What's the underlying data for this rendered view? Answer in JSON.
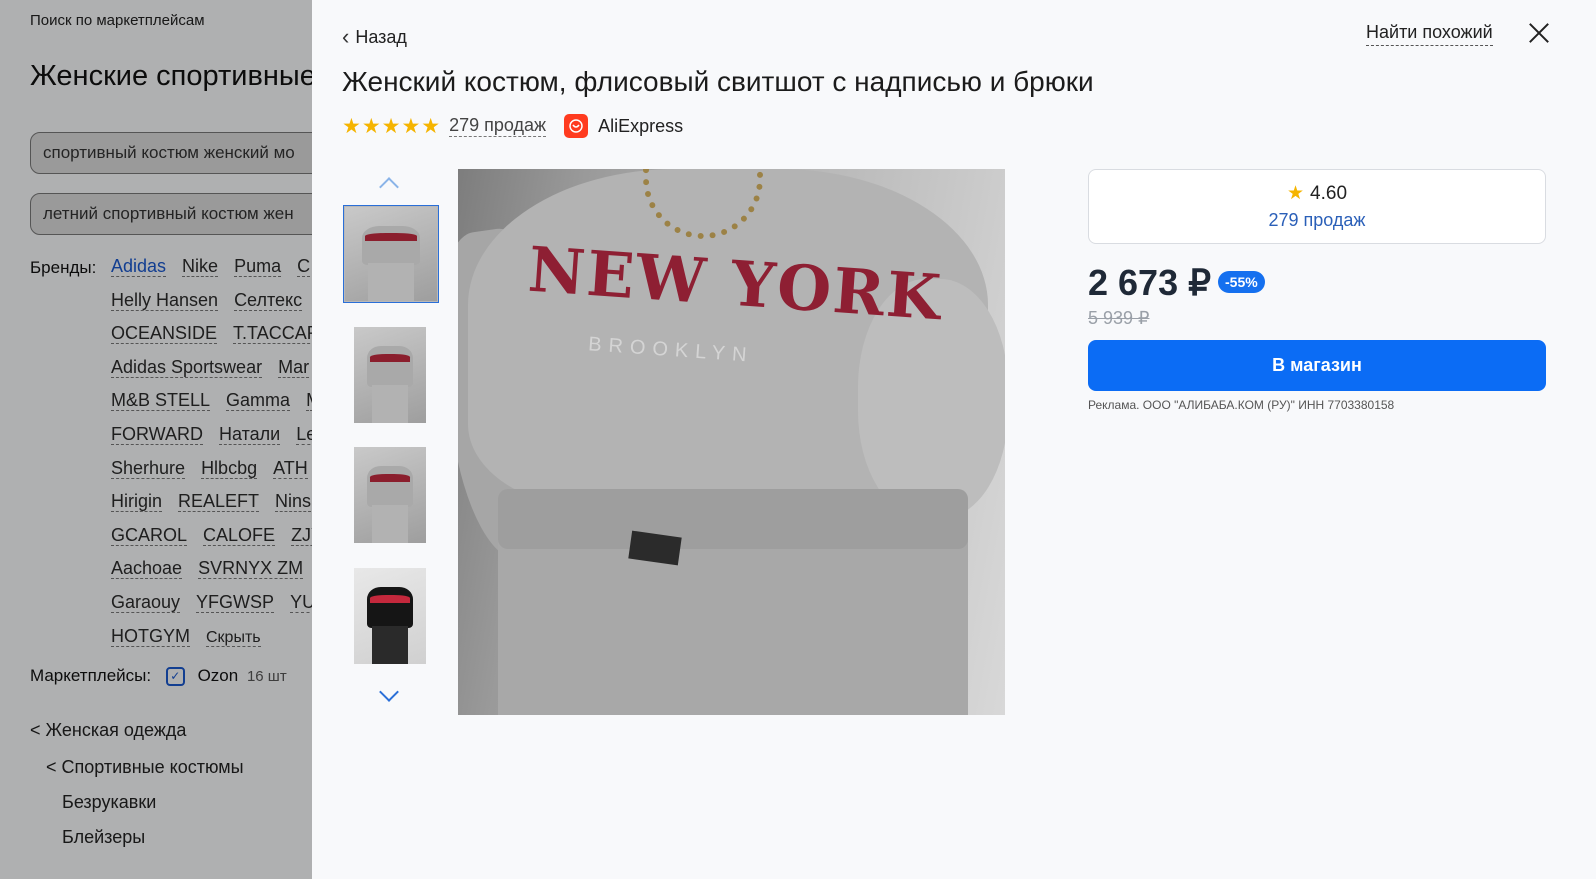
{
  "background": {
    "search_label": "Поиск по маркетплейсам",
    "page_title": "Женские спортивные",
    "query_1": "спортивный костюм женский мо",
    "query_2": "летний спортивный костюм жен",
    "brands_label": "Бренды:",
    "brand_rows": [
      [
        "Adidas",
        "Nike",
        "Puma",
        "C"
      ],
      [
        "Helly Hansen",
        "Селтекс"
      ],
      [
        "OCEANSIDE",
        "T.TACCAR"
      ],
      [
        "Adidas Sportswear",
        "Mar"
      ],
      [
        "M&B STELL",
        "Gamma",
        "M"
      ],
      [
        "FORWARD",
        "Натали",
        "Le"
      ],
      [
        "Sherhure",
        "Hlbcbg",
        "ATH"
      ],
      [
        "Hirigin",
        "REALEFT",
        "Nins"
      ],
      [
        "GCAROL",
        "CALOFE",
        "ZJY"
      ],
      [
        "Aachoae",
        "SVRNYX ZM"
      ],
      [
        "Garaouy",
        "YFGWSP",
        "YU"
      ],
      [
        "HOTGYM"
      ]
    ],
    "hide_label": "Скрыть",
    "marketplaces_label": "Маркетплейсы:",
    "marketplace_name": "Ozon",
    "marketplace_count": "16 шт",
    "categories": [
      "< Женская одежда",
      "< Спортивные костюмы",
      "Безрукавки",
      "Блейзеры"
    ]
  },
  "modal": {
    "back_label": "Назад",
    "find_similar_label": "Найти похожий",
    "product_title": "Женский костюм, флисовый свитшот с надписью и брюки",
    "stars": "★★★★★",
    "sales_link": "279 продаж",
    "store_logo_text": "AliExpress",
    "store_name": "AliExpress",
    "image_texts": {
      "big": "NEW YORK",
      "small": "BROOKLYN"
    },
    "rating_value": "4.60",
    "rating_sales": "279 продаж",
    "price": "2 673 ₽",
    "discount": "-55%",
    "old_price": "5 939 ₽",
    "shop_button": "В магазин",
    "ad_note": "Реклама. ООО \"АЛИБАБА.КОМ (РУ)\" ИНН 7703380158"
  },
  "colors": {
    "accent": "#0b6cf5",
    "star": "#f5b400",
    "discount_bg": "#1570ef",
    "link": "#2a5fb8"
  }
}
